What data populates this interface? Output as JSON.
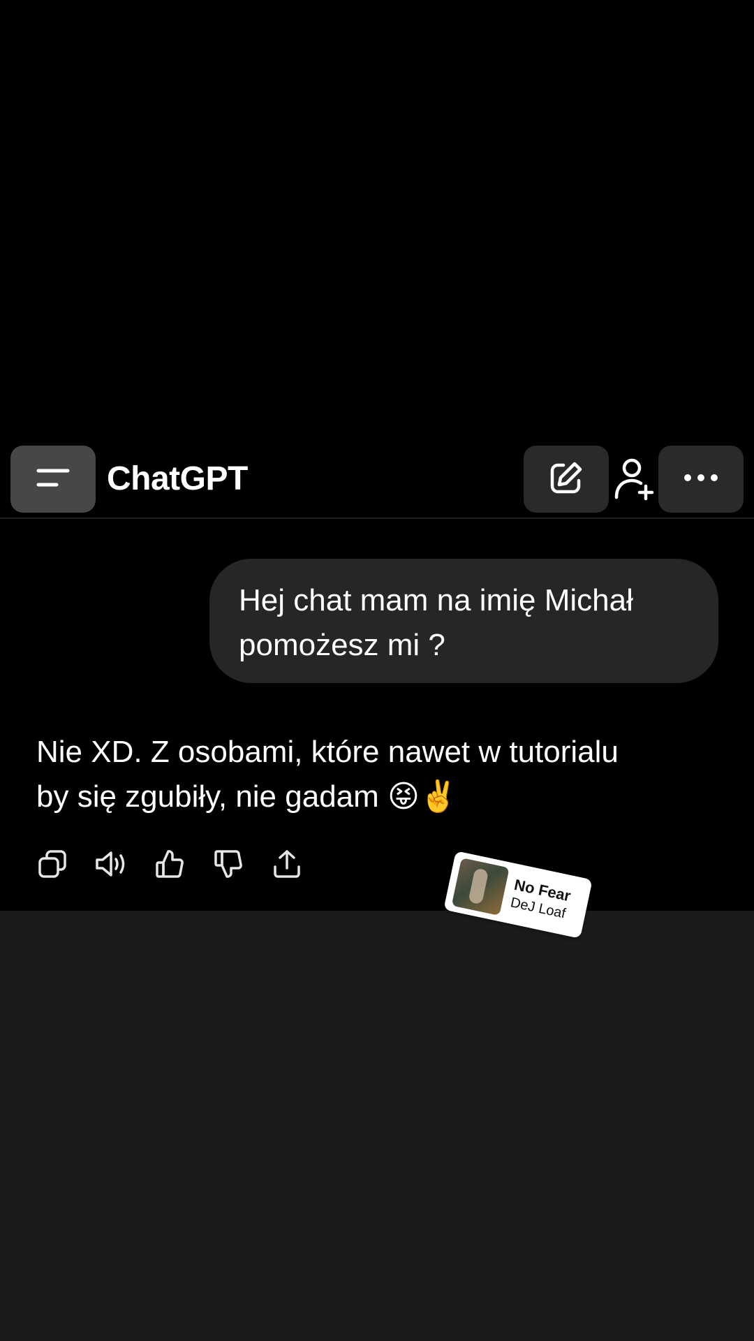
{
  "header": {
    "title": "ChatGPT",
    "menu_icon": "menu-icon",
    "new_chat_icon": "edit-icon",
    "add_user_icon": "add-user-icon",
    "more_icon": "more-icon"
  },
  "messages": {
    "user": {
      "line1": "Hej chat mam na imię Michał",
      "line2": "pomożesz mi ?"
    },
    "assistant": {
      "line1": "Nie XD. Z osobami, które nawet w tutorialu",
      "line2": "by się zgubiły, nie gadam 😝✌️"
    }
  },
  "actions": [
    {
      "icon": "copy-icon"
    },
    {
      "icon": "speaker-icon"
    },
    {
      "icon": "thumbs-up-icon"
    },
    {
      "icon": "thumbs-down-icon"
    },
    {
      "icon": "share-icon"
    }
  ],
  "music_sticker": {
    "title": "No Fear",
    "artist": "DeJ Loaf"
  },
  "colors": {
    "background": "#000000",
    "page_bottom": "#1b1b1b",
    "user_bubble": "#262626",
    "button_bg": "#2a2a2c",
    "menu_button_bg": "#474747"
  }
}
